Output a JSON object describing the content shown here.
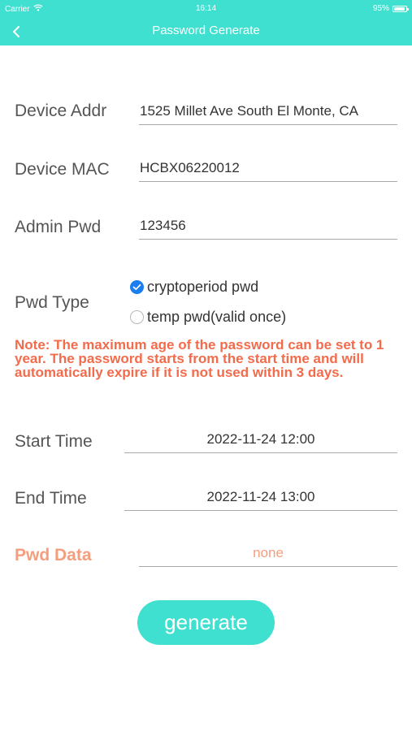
{
  "status_bar": {
    "carrier": "Carrier",
    "time": "16:14",
    "battery": "95%",
    "battery_level": 0.95
  },
  "nav": {
    "title": "Password Generate",
    "back_icon": "chevron-left-icon"
  },
  "form": {
    "device_addr": {
      "label": "Device Addr",
      "value": "1525 Millet Ave South El Monte, CA"
    },
    "device_mac": {
      "label": "Device MAC",
      "value": "HCBX06220012"
    },
    "admin_pwd": {
      "label": "Admin Pwd",
      "value": "123456"
    },
    "pwd_type": {
      "label": "Pwd Type",
      "options": [
        {
          "label": "cryptoperiod pwd",
          "selected": true
        },
        {
          "label": "temp pwd(valid once)",
          "selected": false
        }
      ]
    },
    "note": "Note: The maximum age of the password can be set to 1 year. The password starts from the start time and will automatically expire if it is not used within 3 days.",
    "start_time": {
      "label": "Start Time",
      "value": "2022-11-24 12:00"
    },
    "end_time": {
      "label": "End Time",
      "value": "2022-11-24 13:00"
    },
    "pwd_data": {
      "label": "Pwd Data",
      "value": "none"
    }
  },
  "actions": {
    "generate_label": "generate"
  },
  "colors": {
    "accent": "#40e0d0",
    "note": "#f26b4b",
    "pwd_data": "#f59e7e",
    "radio_selected": "#1a7df0"
  }
}
